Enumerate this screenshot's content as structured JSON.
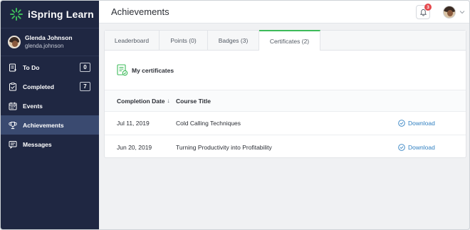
{
  "brand": {
    "name": "iSpring Learn",
    "accent": "#3dbb5a"
  },
  "user": {
    "name": "Glenda Johnson",
    "login": "glenda.johnson"
  },
  "nav": [
    {
      "label": "To Do",
      "icon": "todo-icon",
      "count": "0"
    },
    {
      "label": "Completed",
      "icon": "completed-icon",
      "count": "7"
    },
    {
      "label": "Events",
      "icon": "calendar-icon",
      "count": ""
    },
    {
      "label": "Achievements",
      "icon": "trophy-icon",
      "count": "",
      "active": true
    },
    {
      "label": "Messages",
      "icon": "messages-icon",
      "count": ""
    }
  ],
  "header": {
    "title": "Achievements",
    "notifications": "3"
  },
  "tabs": [
    {
      "label": "Leaderboard"
    },
    {
      "label": "Points (0)"
    },
    {
      "label": "Badges (3)"
    },
    {
      "label": "Certificates (2)",
      "active": true
    }
  ],
  "section": {
    "title": "My certificates"
  },
  "table": {
    "columns": {
      "date": "Completion Date",
      "sort_indicator": "↓",
      "title": "Course Title"
    },
    "rows": [
      {
        "date": "Jul 11, 2019",
        "title": "Cold Calling Techniques",
        "action": "Download"
      },
      {
        "date": "Jun 20, 2019",
        "title": "Turning Productivity into Profitability",
        "action": "Download"
      }
    ]
  },
  "colors": {
    "sidebar": "#1f2742",
    "sidebar_active": "#3a4a70",
    "link": "#2f7fc1",
    "badge": "#e5484d"
  }
}
